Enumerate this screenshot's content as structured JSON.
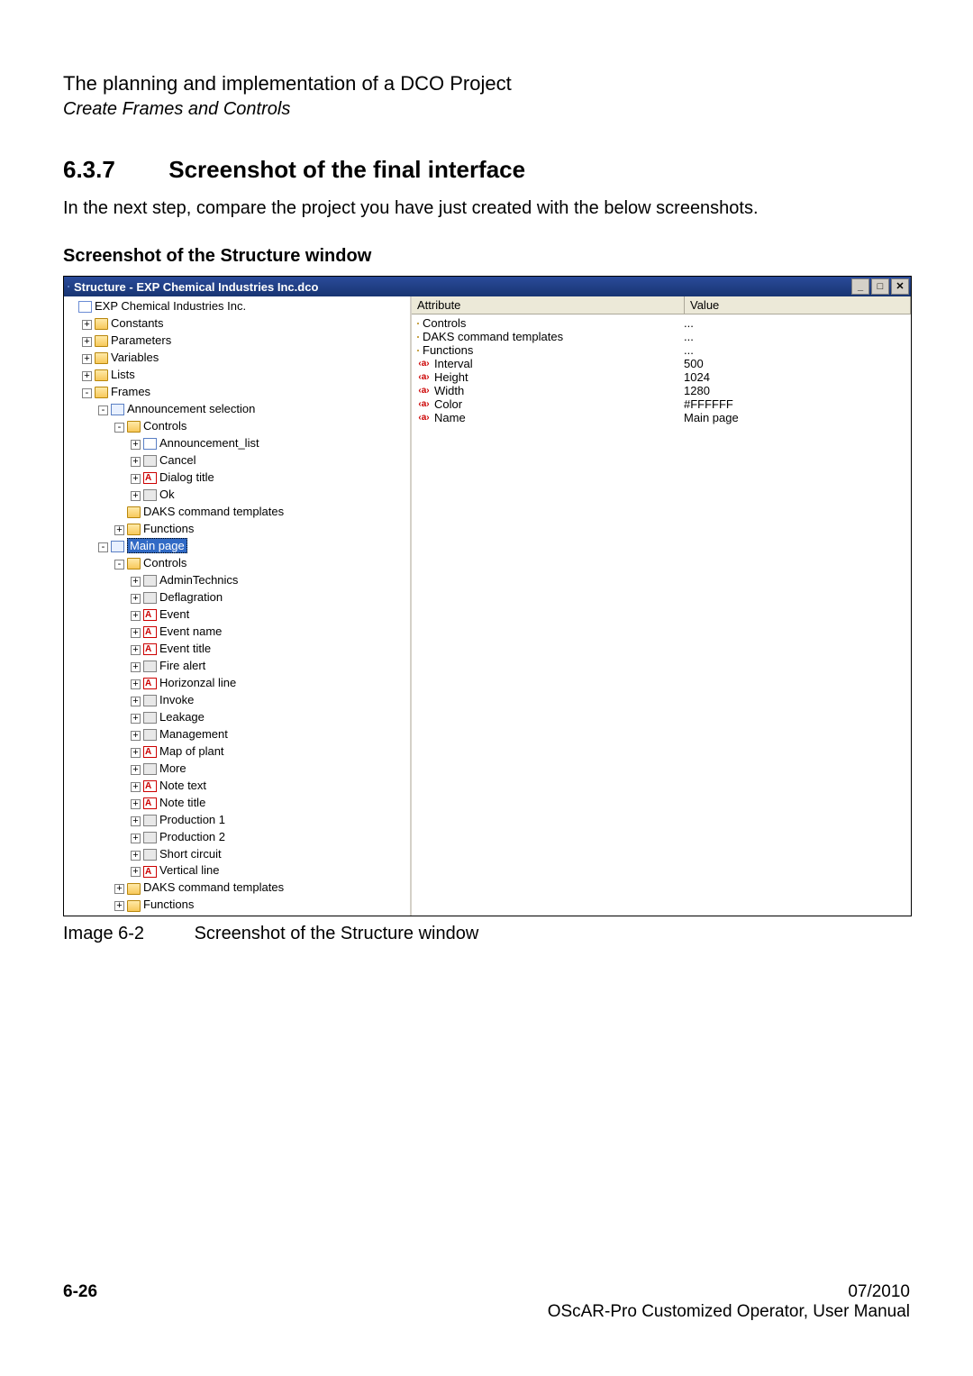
{
  "header": {
    "chapter": "The planning and implementation of a DCO Project",
    "subchapter": "Create Frames and Controls"
  },
  "section": {
    "number": "6.3.7",
    "title": "Screenshot of the final interface"
  },
  "paragraph": "In the next step, compare the project you have just created with the below screenshots.",
  "subheading": "Screenshot of the Structure window",
  "window": {
    "title": "Structure - EXP Chemical Industries Inc.dco",
    "attribute_header": {
      "col_attr": "Attribute",
      "col_val": "Value"
    },
    "attributes": [
      {
        "icon": "folder",
        "name": "Controls",
        "value": "..."
      },
      {
        "icon": "folder",
        "name": "DAKS command templates",
        "value": "..."
      },
      {
        "icon": "folder",
        "name": "Functions",
        "value": "..."
      },
      {
        "icon": "attr",
        "name": "Interval",
        "value": "500"
      },
      {
        "icon": "attr",
        "name": "Height",
        "value": "1024"
      },
      {
        "icon": "attr",
        "name": "Width",
        "value": "1280"
      },
      {
        "icon": "attr",
        "name": "Color",
        "value": "#FFFFFF"
      },
      {
        "icon": "attr",
        "name": "Name",
        "value": "Main page"
      }
    ],
    "tree": [
      {
        "indent": 0,
        "toggle": "",
        "icon": "doc",
        "label": "EXP Chemical Industries Inc."
      },
      {
        "indent": 1,
        "toggle": "+",
        "icon": "folder",
        "label": "Constants"
      },
      {
        "indent": 1,
        "toggle": "+",
        "icon": "folder",
        "label": "Parameters"
      },
      {
        "indent": 1,
        "toggle": "+",
        "icon": "folder",
        "label": "Variables"
      },
      {
        "indent": 1,
        "toggle": "+",
        "icon": "folder",
        "label": "Lists"
      },
      {
        "indent": 1,
        "toggle": "-",
        "icon": "folder-open",
        "label": "Frames"
      },
      {
        "indent": 2,
        "toggle": "-",
        "icon": "frame",
        "label": "Announcement selection"
      },
      {
        "indent": 3,
        "toggle": "-",
        "icon": "folder-open",
        "label": "Controls"
      },
      {
        "indent": 4,
        "toggle": "+",
        "icon": "list",
        "label": "Announcement_list"
      },
      {
        "indent": 4,
        "toggle": "+",
        "icon": "button",
        "label": "Cancel"
      },
      {
        "indent": 4,
        "toggle": "+",
        "icon": "text",
        "label": "Dialog title"
      },
      {
        "indent": 4,
        "toggle": "+",
        "icon": "button",
        "label": "Ok"
      },
      {
        "indent": 3,
        "toggle": "",
        "icon": "folder",
        "label": "DAKS command templates"
      },
      {
        "indent": 3,
        "toggle": "+",
        "icon": "folder",
        "label": "Functions"
      },
      {
        "indent": 2,
        "toggle": "-",
        "icon": "frame",
        "label": "Main page",
        "selected": true
      },
      {
        "indent": 3,
        "toggle": "-",
        "icon": "folder-open",
        "label": "Controls"
      },
      {
        "indent": 4,
        "toggle": "+",
        "icon": "button",
        "label": "AdminTechnics"
      },
      {
        "indent": 4,
        "toggle": "+",
        "icon": "button",
        "label": "Deflagration"
      },
      {
        "indent": 4,
        "toggle": "+",
        "icon": "text",
        "label": "Event"
      },
      {
        "indent": 4,
        "toggle": "+",
        "icon": "text",
        "label": "Event name"
      },
      {
        "indent": 4,
        "toggle": "+",
        "icon": "text",
        "label": "Event title"
      },
      {
        "indent": 4,
        "toggle": "+",
        "icon": "button",
        "label": "Fire alert"
      },
      {
        "indent": 4,
        "toggle": "+",
        "icon": "text",
        "label": "Horizonzal line"
      },
      {
        "indent": 4,
        "toggle": "+",
        "icon": "button",
        "label": "Invoke"
      },
      {
        "indent": 4,
        "toggle": "+",
        "icon": "button",
        "label": "Leakage"
      },
      {
        "indent": 4,
        "toggle": "+",
        "icon": "button",
        "label": "Management"
      },
      {
        "indent": 4,
        "toggle": "+",
        "icon": "text",
        "label": "Map of plant"
      },
      {
        "indent": 4,
        "toggle": "+",
        "icon": "button",
        "label": "More"
      },
      {
        "indent": 4,
        "toggle": "+",
        "icon": "text",
        "label": "Note text"
      },
      {
        "indent": 4,
        "toggle": "+",
        "icon": "text",
        "label": "Note title"
      },
      {
        "indent": 4,
        "toggle": "+",
        "icon": "button",
        "label": "Production 1"
      },
      {
        "indent": 4,
        "toggle": "+",
        "icon": "button",
        "label": "Production 2"
      },
      {
        "indent": 4,
        "toggle": "+",
        "icon": "button",
        "label": "Short circuit"
      },
      {
        "indent": 4,
        "toggle": "+",
        "icon": "text",
        "label": "Vertical line"
      },
      {
        "indent": 3,
        "toggle": "+",
        "icon": "folder",
        "label": "DAKS command templates"
      },
      {
        "indent": 3,
        "toggle": "+",
        "icon": "folder",
        "label": "Functions"
      }
    ]
  },
  "caption": {
    "num": "Image 6-2",
    "text": "Screenshot of the Structure window"
  },
  "footer": {
    "page": "6-26",
    "date": "07/2010",
    "doc": "OScAR-Pro Customized Operator, User Manual"
  }
}
